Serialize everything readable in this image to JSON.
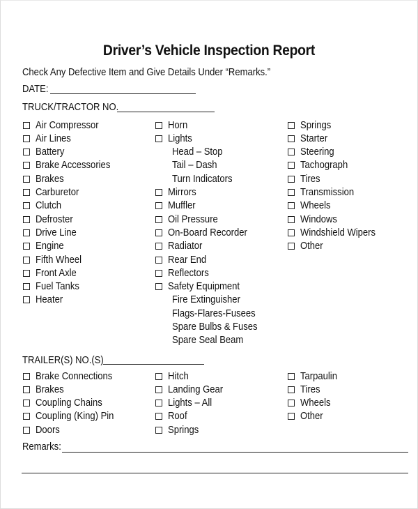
{
  "title": "Driver’s Vehicle Inspection Report",
  "instructions": "Check Any Defective Item and Give Details Under “Remarks.”",
  "fields": {
    "date_label": "DATE:",
    "date_value": "",
    "truck_label": "TRUCK/TRACTOR NO.",
    "truck_value": "",
    "trailer_label": "TRAILER(S) NO.(S)",
    "trailer_value": "",
    "remarks_label": "Remarks:",
    "remarks_value": ""
  },
  "truck_items": {
    "col1": [
      {
        "label": "Air Compressor",
        "checkbox": true,
        "checked": false
      },
      {
        "label": "Air Lines",
        "checkbox": true,
        "checked": false
      },
      {
        "label": "Battery",
        "checkbox": true,
        "checked": false
      },
      {
        "label": "Brake Accessories",
        "checkbox": true,
        "checked": false
      },
      {
        "label": "Brakes",
        "checkbox": true,
        "checked": false
      },
      {
        "label": "Carburetor",
        "checkbox": true,
        "checked": false
      },
      {
        "label": "Clutch",
        "checkbox": true,
        "checked": false
      },
      {
        "label": "Defroster",
        "checkbox": true,
        "checked": false
      },
      {
        "label": "Drive Line",
        "checkbox": true,
        "checked": false
      },
      {
        "label": "Engine",
        "checkbox": true,
        "checked": false
      },
      {
        "label": "Fifth Wheel",
        "checkbox": true,
        "checked": false
      },
      {
        "label": "Front Axle",
        "checkbox": true,
        "checked": false
      },
      {
        "label": "Fuel Tanks",
        "checkbox": true,
        "checked": false
      },
      {
        "label": "Heater",
        "checkbox": true,
        "checked": false
      }
    ],
    "col2": [
      {
        "label": "Horn",
        "checkbox": true,
        "checked": false
      },
      {
        "label": "Lights",
        "checkbox": true,
        "checked": false
      },
      {
        "label": "Head – Stop",
        "checkbox": false
      },
      {
        "label": "Tail – Dash",
        "checkbox": false
      },
      {
        "label": "Turn Indicators",
        "checkbox": false
      },
      {
        "label": "Mirrors",
        "checkbox": true,
        "checked": false
      },
      {
        "label": "Muffler",
        "checkbox": true,
        "checked": false
      },
      {
        "label": "Oil Pressure",
        "checkbox": true,
        "checked": false
      },
      {
        "label": "On-Board Recorder",
        "checkbox": true,
        "checked": false
      },
      {
        "label": "Radiator",
        "checkbox": true,
        "checked": false
      },
      {
        "label": "Rear End",
        "checkbox": true,
        "checked": false
      },
      {
        "label": "Reflectors",
        "checkbox": true,
        "checked": false
      },
      {
        "label": "Safety Equipment",
        "checkbox": true,
        "checked": false
      },
      {
        "label": "Fire Extinguisher",
        "checkbox": false
      },
      {
        "label": "Flags-Flares-Fusees",
        "checkbox": false
      },
      {
        "label": "Spare Bulbs & Fuses",
        "checkbox": false
      },
      {
        "label": "Spare Seal Beam",
        "checkbox": false
      }
    ],
    "col3": [
      {
        "label": "Springs",
        "checkbox": true,
        "checked": false
      },
      {
        "label": "Starter",
        "checkbox": true,
        "checked": false
      },
      {
        "label": "Steering",
        "checkbox": true,
        "checked": false
      },
      {
        "label": "Tachograph",
        "checkbox": true,
        "checked": false
      },
      {
        "label": "Tires",
        "checkbox": true,
        "checked": false
      },
      {
        "label": "Transmission",
        "checkbox": true,
        "checked": false
      },
      {
        "label": "Wheels",
        "checkbox": true,
        "checked": false
      },
      {
        "label": "Windows",
        "checkbox": true,
        "checked": false
      },
      {
        "label": "Windshield Wipers",
        "checkbox": true,
        "checked": false
      },
      {
        "label": "Other",
        "checkbox": true,
        "checked": false
      }
    ]
  },
  "trailer_items": {
    "col1": [
      {
        "label": "Brake Connections",
        "checkbox": true,
        "checked": false
      },
      {
        "label": "Brakes",
        "checkbox": true,
        "checked": false
      },
      {
        "label": "Coupling Chains",
        "checkbox": true,
        "checked": false
      },
      {
        "label": "Coupling (King) Pin",
        "checkbox": true,
        "checked": false
      },
      {
        "label": "Doors",
        "checkbox": true,
        "checked": false
      }
    ],
    "col2": [
      {
        "label": "Hitch",
        "checkbox": true,
        "checked": false
      },
      {
        "label": "Landing Gear",
        "checkbox": true,
        "checked": false
      },
      {
        "label": "Lights – All",
        "checkbox": true,
        "checked": false
      },
      {
        "label": "Roof",
        "checkbox": true,
        "checked": false
      },
      {
        "label": "Springs",
        "checkbox": true,
        "checked": false
      }
    ],
    "col3": [
      {
        "label": "Tarpaulin",
        "checkbox": true,
        "checked": false
      },
      {
        "label": "Tires",
        "checkbox": true,
        "checked": false
      },
      {
        "label": "Wheels",
        "checkbox": true,
        "checked": false
      },
      {
        "label": "Other",
        "checkbox": true,
        "checked": false
      }
    ]
  }
}
